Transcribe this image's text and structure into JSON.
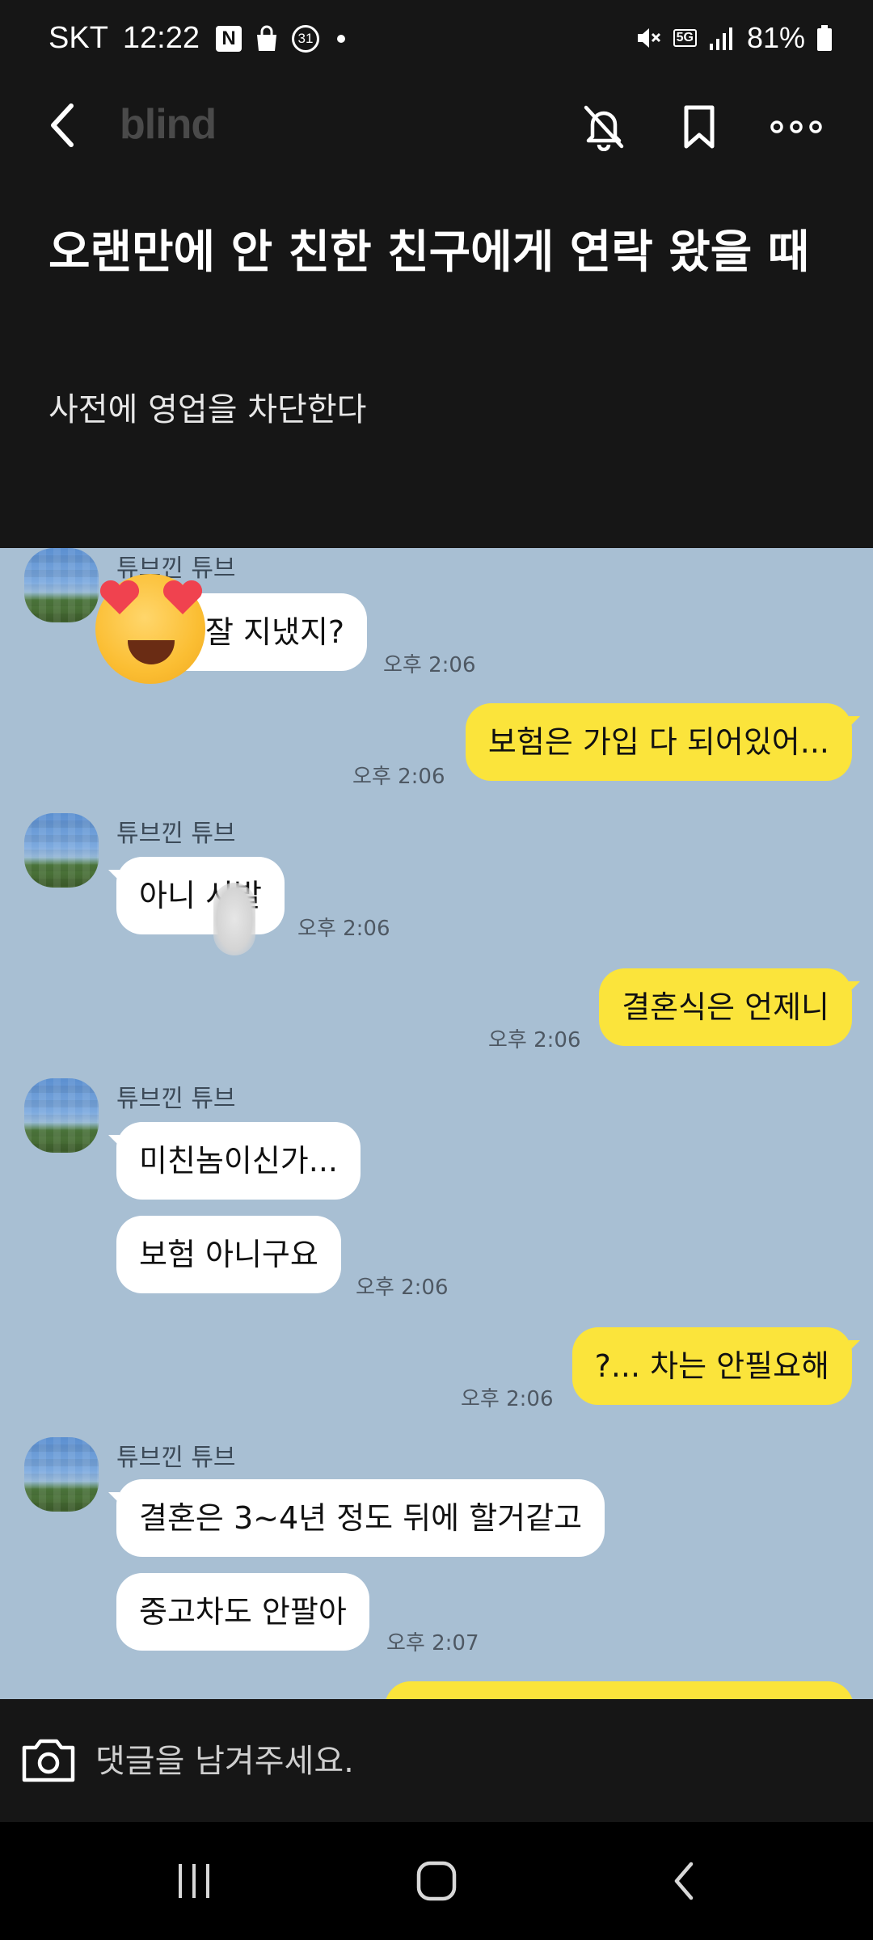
{
  "status_bar": {
    "carrier": "SKT",
    "time": "12:22",
    "notification_icons": [
      "naver-icon",
      "shopping-bag-icon",
      "calendar-icon",
      "dot-icon"
    ],
    "calendar_day": "31",
    "network": "5G",
    "battery": "81%"
  },
  "header": {
    "brand": "blind",
    "icons": [
      "back-arrow-icon",
      "bell-off-icon",
      "bookmark-icon",
      "more-icon"
    ]
  },
  "post": {
    "title": "오랜만에 안 친한 친구에게 연락 왔을 때",
    "body": "사전에 영업을 차단한다"
  },
  "chat": {
    "sender": "튜브낀 튜브",
    "messages": [
      {
        "side": "in",
        "text": "잘 지냈지?",
        "time": "오후 2:06"
      },
      {
        "side": "out",
        "text": "보험은 가입 다 되어있어...",
        "time": "오후 2:06"
      },
      {
        "side": "in",
        "text": "아니 시발",
        "time": "오후 2:06"
      },
      {
        "side": "out",
        "text": "결혼식은 언제니",
        "time": "오후 2:06"
      },
      {
        "side": "in",
        "text": "미친놈이신가...",
        "time": ""
      },
      {
        "side": "in",
        "text": "보험 아니구요",
        "time": "오후 2:06"
      },
      {
        "side": "out",
        "text": "?... 차는 안필요해",
        "time": "오후 2:06"
      },
      {
        "side": "in",
        "text": "결혼은 3~4년 정도 뒤에 할거같고",
        "time": ""
      },
      {
        "side": "in",
        "text": "중고차도 안팔아",
        "time": "오후 2:07"
      }
    ],
    "colors": {
      "background": "#a8bfd3",
      "incoming": "#ffffff",
      "outgoing": "#fbe43b"
    }
  },
  "comment": {
    "placeholder": "댓글을 남겨주세요."
  },
  "nav": {
    "icons": [
      "recent-apps-icon",
      "home-icon",
      "back-icon"
    ]
  }
}
